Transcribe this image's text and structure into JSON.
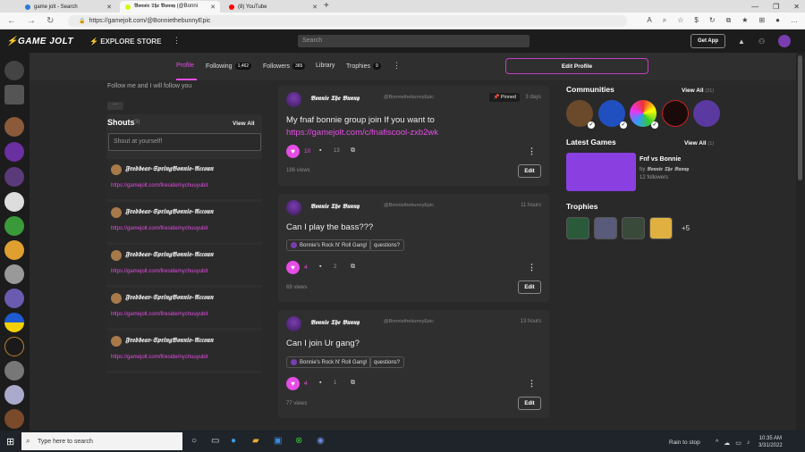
{
  "browser": {
    "tabs": [
      {
        "label": "game jolt - Search"
      },
      {
        "label": "𝕭𝖔𝖓𝖓𝖎𝖊 𝕿𝖍𝖊 𝕭𝖚𝖓𝖓𝖞 (@Bonni"
      },
      {
        "label": "(8) YouTube"
      }
    ],
    "url": "https://gamejolt.com/@BonniethebunnyEpic"
  },
  "site": {
    "logo": "GAME JOLT",
    "explore": "EXPLORE",
    "store": "STORE",
    "search_placeholder": "Search",
    "get_app": "Get App"
  },
  "profile_nav": {
    "profile": "Profile",
    "following": "Following",
    "following_count": "1,462",
    "followers": "Followers",
    "followers_count": "365",
    "library": "Library",
    "trophies": "Trophies",
    "trophies_count": "9",
    "edit_profile": "Edit Profile"
  },
  "left": {
    "follow_text": "Follow me and I will follow you",
    "more_btn": "···",
    "shouts_title": "Shouts",
    "shouts_count": "(3)",
    "view_all": "View All",
    "shout_placeholder": "Shout at yourself!",
    "shouts": [
      {
        "name": "𝕱𝖗𝖊𝖉𝖇𝖊𝖆𝖗-𝕾𝖕𝖗𝖎𝖓𝖌𝕭𝖔𝖓𝖓𝖎𝖊-𝕬𝖈𝖈𝖔𝖚𝖓",
        "link": "https://gamejolt.com/fireside/nychuuyubit"
      },
      {
        "name": "𝕱𝖗𝖊𝖉𝖇𝖊𝖆𝖗-𝕾𝖕𝖗𝖎𝖓𝖌𝕭𝖔𝖓𝖓𝖎𝖊-𝕬𝖈𝖈𝖔𝖚𝖓",
        "link": "https://gamejolt.com/fireside/nychuuyubit"
      },
      {
        "name": "𝕱𝖗𝖊𝖉𝖇𝖊𝖆𝖗-𝕾𝖕𝖗𝖎𝖓𝖌𝕭𝖔𝖓𝖓𝖎𝖊-𝕬𝖈𝖈𝖔𝖚𝖓",
        "link": "https://gamejolt.com/fireside/nychuuyubit"
      },
      {
        "name": "𝕱𝖗𝖊𝖉𝖇𝖊𝖆𝖗-𝕾𝖕𝖗𝖎𝖓𝖌𝕭𝖔𝖓𝖓𝖎𝖊-𝕬𝖈𝖈𝖔𝖚𝖓",
        "link": "https://gamejolt.com/fireside/nychuuyubit"
      },
      {
        "name": "𝕱𝖗𝖊𝖉𝖇𝖊𝖆𝖗-𝕾𝖕𝖗𝖎𝖓𝖌𝕭𝖔𝖓𝖓𝖎𝖊-𝕬𝖈𝖈𝖔𝖚𝖓",
        "link": "https://gamejolt.com/fireside/nychuuyubit"
      }
    ]
  },
  "posts": [
    {
      "user": "𝕭𝖔𝖓𝖓𝖎𝖊 𝕿𝖍𝖊 𝕭𝖚𝖓𝖓𝖞",
      "handle": "@BonniethebunnyEpic",
      "pinned": "Pinned",
      "time": "3 days",
      "body": "My fnaf bonnie group join If you want to",
      "link": "https://gamejolt.com/c/fnafiscool-zxb2wk",
      "likes": "10",
      "comments": "13",
      "views": "186 views",
      "edit": "Edit"
    },
    {
      "user": "𝕭𝖔𝖓𝖓𝖎𝖊 𝕿𝖍𝖊 𝕭𝖚𝖓𝖓𝖞",
      "handle": "@BonniethebunnyEpic",
      "time": "11 hours",
      "body": "Can I play the bass???",
      "tag1": "Bonnie's Rock N' Roll Gang!",
      "tag2": "questions?",
      "likes": "4",
      "comments": "2",
      "views": "69 views",
      "edit": "Edit"
    },
    {
      "user": "𝕭𝖔𝖓𝖓𝖎𝖊 𝕿𝖍𝖊 𝕭𝖚𝖓𝖓𝖞",
      "handle": "@BonniethebunnyEpic",
      "time": "13 hours",
      "body": "Can I join Ur gang?",
      "tag1": "Bonnie's Rock N' Roll Gang!",
      "tag2": "questions?",
      "likes": "4",
      "comments": "1",
      "views": "77 views",
      "edit": "Edit"
    }
  ],
  "right": {
    "communities_title": "Communities",
    "communities_view_all": "View All",
    "communities_count": "(21)",
    "latest_games_title": "Latest Games",
    "games_view_all": "View All",
    "games_count": "(1)",
    "game_title": "Fnf vs Bonnie",
    "game_by": "by",
    "game_author": "𝕭𝖔𝖓𝖓𝖎𝖊 𝕿𝖍𝖊 𝕭𝖚𝖓𝖓𝖞",
    "game_followers": "12 followers",
    "trophies_title": "Trophies",
    "trophies_more": "+5"
  },
  "taskbar": {
    "search_placeholder": "Type here to search",
    "weather": "Rain to stop",
    "time": "10:35 AM",
    "date": "3/31/2022"
  },
  "colors": {
    "accent": "#e54de5",
    "background": "#292929",
    "panel": "#2f2f2f"
  }
}
